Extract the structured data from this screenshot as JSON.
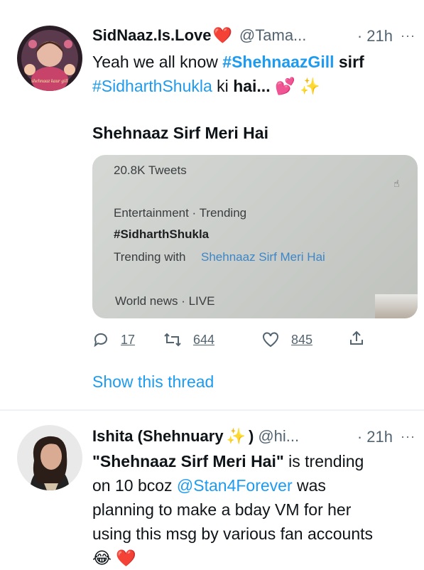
{
  "tweets": [
    {
      "name": "SidNaaz.Is.Love",
      "name_emoji": "❤️",
      "handle": "@Tama...",
      "time": "· 21h",
      "more": "···",
      "text_line1_pre": "Yeah we all know ",
      "text_tag1": "#ShehnaazGill",
      "text_line1_post": " sirf",
      "text_tag2": "#SidharthShukla",
      "text_line2_mid": " ki ",
      "text_bold": "hai...",
      "text_emojis": "💕 ✨",
      "avatar_caption": "shehnaaz kaur gill",
      "media_title": "Shehnaaz Sirf Meri Hai",
      "media": {
        "tweets_count": "20.8K Tweets",
        "category": "Entertainment · Trending",
        "hashtag": "#SidharthShukla",
        "trending_with_label": "Trending with",
        "trending_with_value": "Shehnaaz Sirf Meri Hai",
        "news_label": "World news · LIVE"
      },
      "reply_count": "17",
      "retweet_count": "644",
      "like_count": "845",
      "show_thread": "Show this thread"
    },
    {
      "name": "Ishita (Shehnuary ",
      "name_sparkle": "✨",
      "name_close": ")",
      "handle": "@hi...",
      "time": "· 21h",
      "more": "···",
      "line1_quote": "\"Shehnaaz Sirf Meri Hai\"",
      "line1_rest": " is trending",
      "line2_pre": "on 10 bcoz ",
      "line2_mention": "@Stan4Forever",
      "line2_post": " was",
      "line3": "planning to make a bday VM for her",
      "line4": "using this msg by various fan accounts",
      "line5_emojis": "😂 ❤️"
    }
  ],
  "colors": {
    "link": "#1d9bf0",
    "muted": "#536471",
    "divider": "#eff3f4"
  },
  "icons": [
    "reply-icon",
    "retweet-icon",
    "like-icon",
    "share-icon",
    "more-icon"
  ]
}
